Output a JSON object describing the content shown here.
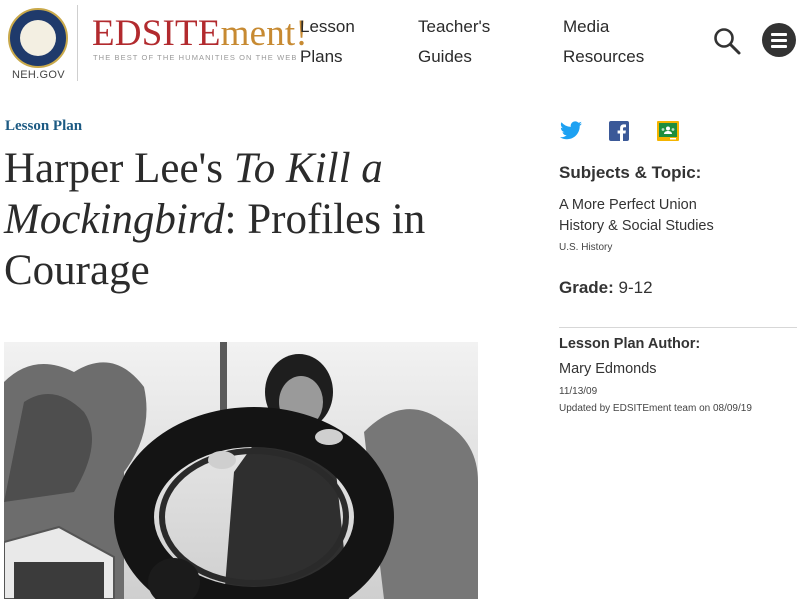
{
  "header": {
    "neh_label": "NEH.GOV",
    "brand_main": "EDSITE",
    "brand_ment": "ment!",
    "tagline": "THE BEST OF THE HUMANITIES ON THE WEB",
    "nav": [
      {
        "line1": "Lesson",
        "line2": "Plans"
      },
      {
        "line1": "Teacher's",
        "line2": "Guides"
      },
      {
        "line1": "Media",
        "line2": "Resources"
      }
    ],
    "search_icon": "search-icon",
    "menu_icon": "hamburger-menu-icon"
  },
  "main": {
    "eyebrow": "Lesson Plan",
    "title_part1": "Harper Lee's ",
    "title_italic": "To Kill a Mockingbird",
    "title_part2": ": Profiles in Courage"
  },
  "sidebar": {
    "share_icons": [
      "twitter-icon",
      "facebook-icon",
      "google-classroom-icon"
    ],
    "subjects_heading": "Subjects & Topic:",
    "subject_links": [
      "A More Perfect Union",
      "History & Social Studies"
    ],
    "subject_small": "U.S. History",
    "grade_label": "Grade:",
    "grade_value": " 9-12",
    "author_heading": "Lesson Plan Author:",
    "author_name": "Mary Edmonds",
    "date": "11/13/09",
    "updated": "Updated by EDSITEment team on 08/09/19"
  },
  "colors": {
    "brand_red": "#b22a2e",
    "brand_gold": "#c78a32",
    "eyebrow_blue": "#1c5a83",
    "twitter": "#1da1f2",
    "facebook": "#3b5998",
    "classroom": "#1e8e3e"
  }
}
